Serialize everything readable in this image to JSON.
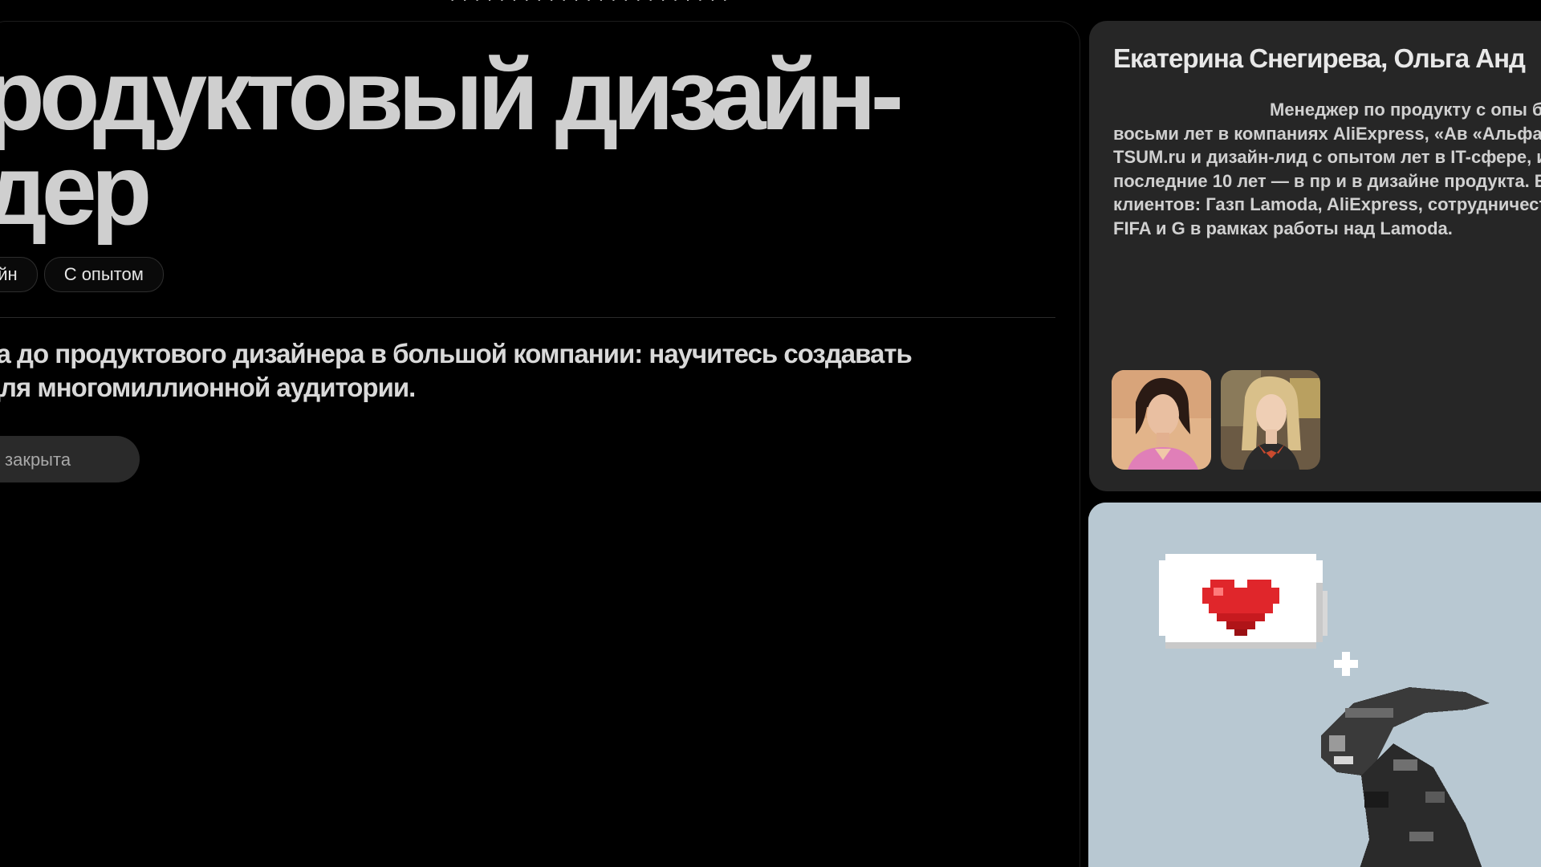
{
  "nav": {
    "top_strip": "  ·  ·  ·  ·  ·  ·  ·  ·  ·  ·  ·  ·  ·  ·  ·  ·  ·  ·  ·  ·  ·  ·  ·"
  },
  "hero": {
    "title_line1": "родуктовый дизайн-",
    "title_line2": "дер",
    "tags": [
      "айн",
      "С опытом"
    ],
    "description_line1": "ка до продуктового дизайнера в большой компании: научитесь создавать",
    "description_line2": "для многомиллионной аудитории.",
    "closed_button_label": "закрыта"
  },
  "authors": {
    "names": "Екатерина Снегирева, Ольга Анд",
    "bio": "Менеджер по продукту с опы более восьми лет в компаниях AliExpress, «Ав «Альфа-Банк», TSUM.ru и дизайн-лид с опытом лет в IT-сфере, из них последние 10 лет — в пр и в дизайне продукта. В числе клиентов: Газп Lamoda, AliExpress, сотрудничество с FIFA и G в рамках работы над Lamoda.",
    "avatars": [
      {
        "icon": "author-photo-1-icon",
        "bg": "#e2b48a"
      },
      {
        "icon": "author-photo-2-icon",
        "bg": "#b9a98a"
      }
    ]
  },
  "illustration": {
    "icon": "pixel-alien-heart-icon",
    "background": "#b8c8d2",
    "heart_color": "#e0262b"
  },
  "colors": {
    "page_bg": "#000000",
    "card_bg": "#262626",
    "title_color": "#cfcfcf"
  }
}
